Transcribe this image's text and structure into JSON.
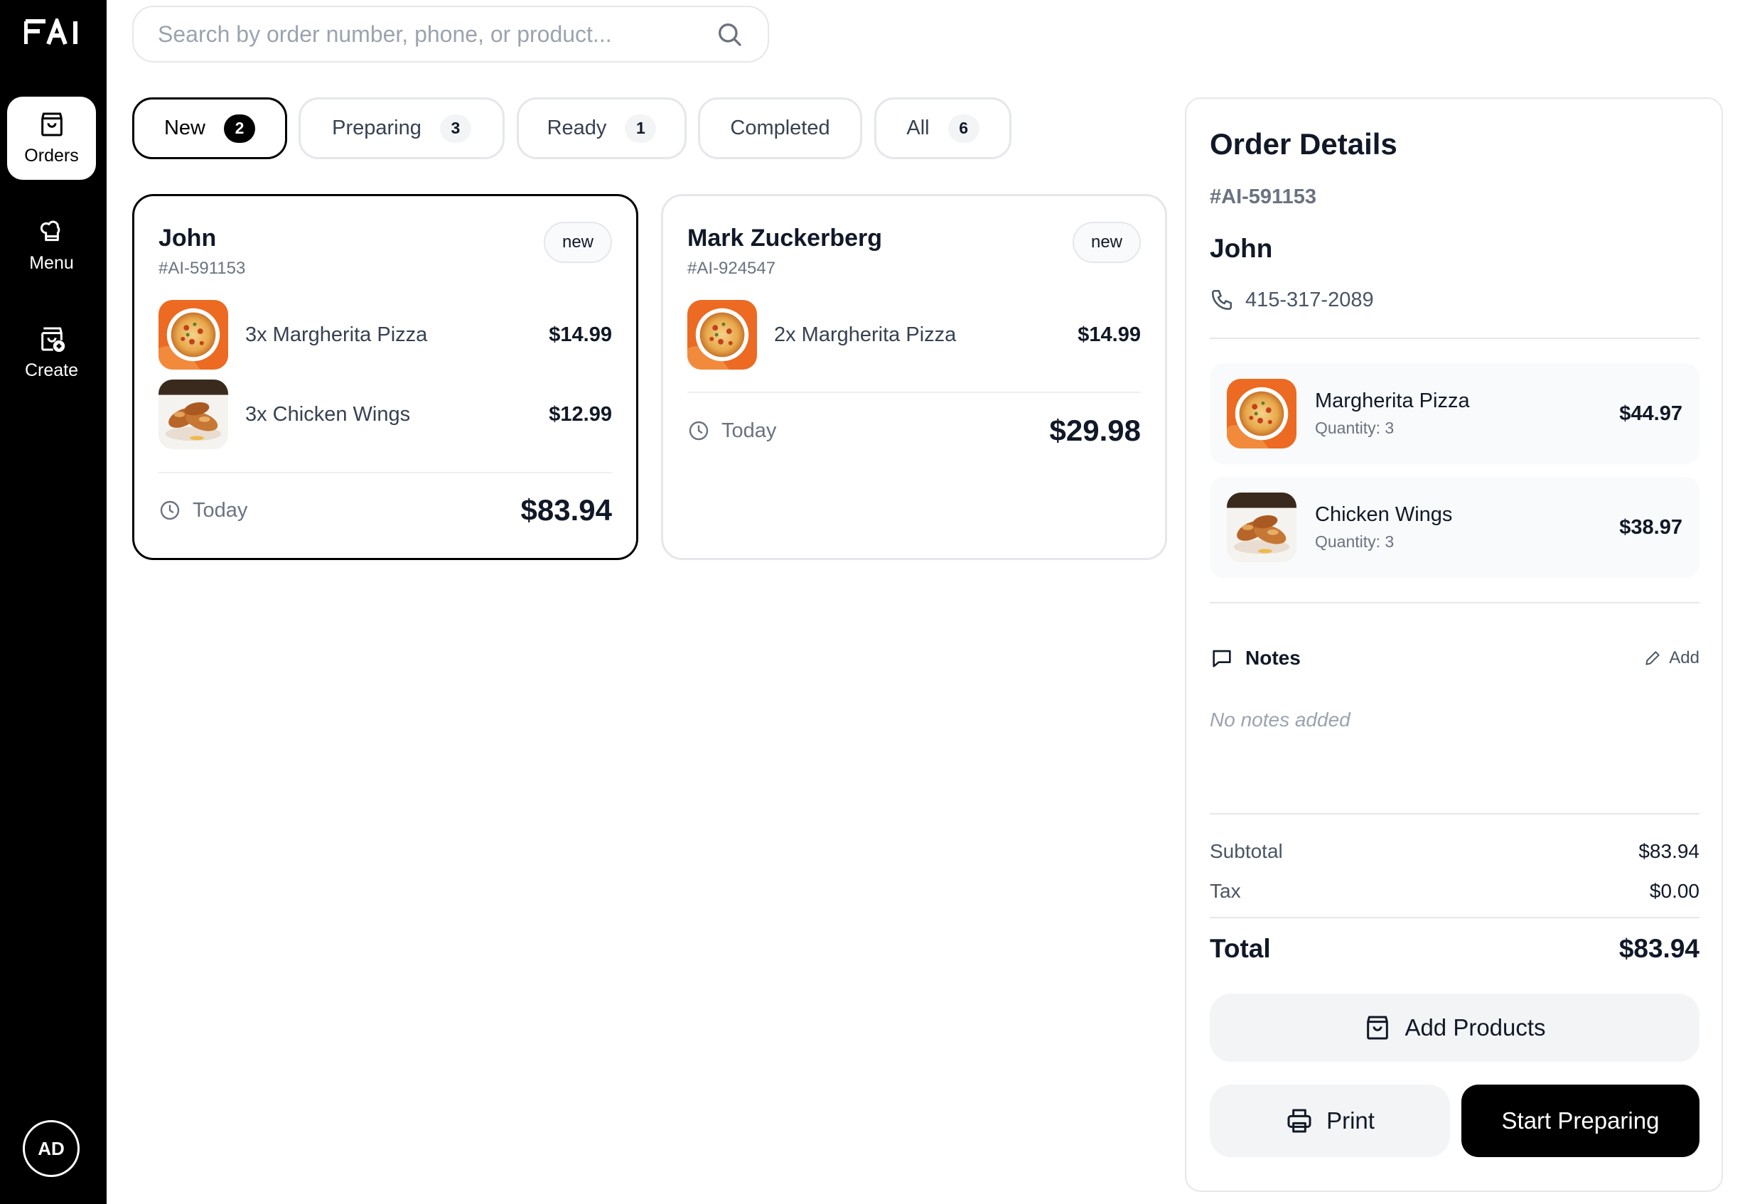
{
  "sidebar": {
    "logo_text": "FAI",
    "items": [
      {
        "label": "Orders",
        "icon": "shopping-bag-icon",
        "active": true
      },
      {
        "label": "Menu",
        "icon": "chef-hat-icon",
        "active": false
      },
      {
        "label": "Create",
        "icon": "bag-plus-icon",
        "active": false
      }
    ],
    "avatar_initials": "AD"
  },
  "search": {
    "placeholder": "Search by order number, phone, or product...",
    "value": ""
  },
  "tabs": [
    {
      "label": "New",
      "count": "2",
      "active": true
    },
    {
      "label": "Preparing",
      "count": "3",
      "active": false
    },
    {
      "label": "Ready",
      "count": "1",
      "active": false
    },
    {
      "label": "Completed",
      "count": "",
      "active": false
    },
    {
      "label": "All",
      "count": "6",
      "active": false
    }
  ],
  "orders": [
    {
      "name": "John",
      "id": "#AI-591153",
      "status": "new",
      "items": [
        {
          "text": "3x Margherita Pizza",
          "price": "$14.99",
          "image": "pizza"
        },
        {
          "text": "3x Chicken Wings",
          "price": "$12.99",
          "image": "wings"
        }
      ],
      "time": "Today",
      "total": "$83.94",
      "selected": true
    },
    {
      "name": "Mark Zuckerberg",
      "id": "#AI-924547",
      "status": "new",
      "items": [
        {
          "text": "2x Margherita Pizza",
          "price": "$14.99",
          "image": "pizza"
        }
      ],
      "time": "Today",
      "total": "$29.98",
      "selected": false
    }
  ],
  "details": {
    "title": "Order Details",
    "order_id": "#AI-591153",
    "customer": "John",
    "phone": "415-317-2089",
    "items": [
      {
        "name": "Margherita Pizza",
        "quantity": "Quantity: 3",
        "price": "$44.97",
        "image": "pizza"
      },
      {
        "name": "Chicken Wings",
        "quantity": "Quantity: 3",
        "price": "$38.97",
        "image": "wings"
      }
    ],
    "notes_label": "Notes",
    "notes_add": "Add",
    "notes_empty": "No notes added",
    "subtotal_label": "Subtotal",
    "subtotal": "$83.94",
    "tax_label": "Tax",
    "tax": "$0.00",
    "total_label": "Total",
    "total": "$83.94",
    "add_products": "Add Products",
    "print": "Print",
    "start": "Start Preparing"
  },
  "colors": {
    "sidebar_bg": "#000000",
    "accent": "#000000",
    "border": "#e5e7eb",
    "muted_text": "#6b7280"
  }
}
